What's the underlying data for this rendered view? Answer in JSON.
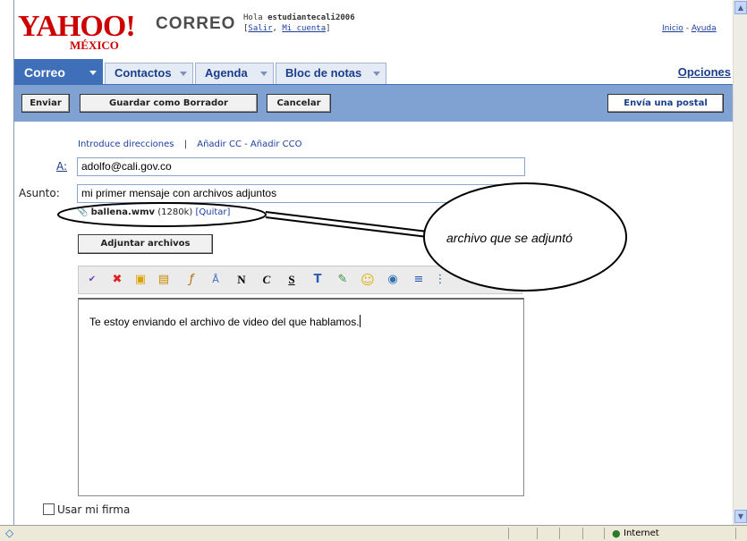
{
  "header": {
    "logo_text": "YAHOO!",
    "logo_region": "MÉXICO",
    "product": "CORREO",
    "greeting": "Hola",
    "username": "estudiantecali2006",
    "exit_link": "Salir",
    "account_link": "Mi cuenta",
    "home_link": "Inicio",
    "help_link": "Ayuda",
    "link_sep": "-"
  },
  "nav": {
    "tabs": [
      {
        "label": "Correo"
      },
      {
        "label": "Contactos"
      },
      {
        "label": "Agenda"
      },
      {
        "label": "Bloc de notas"
      }
    ],
    "options_label": "Opciones"
  },
  "actions": {
    "send": "Enviar",
    "save_draft": "Guardar como Borrador",
    "cancel": "Cancelar",
    "postcard": "Envía una postal"
  },
  "compose": {
    "insert_addresses": "Introduce direcciones",
    "add_cc": "Añadir CC",
    "add_bcc": "Añadir CCO",
    "cc_sep": "-",
    "pipe": "|",
    "to_label": "A:",
    "to_value": "adolfo@cali.gov.co",
    "subject_label": "Asunto:",
    "subject_value": "mi primer mensaje con archivos adjuntos",
    "attachment_name": "ballena.wmv",
    "attachment_size": "(1280k)",
    "attachment_remove": "[Quitar]",
    "attach_button": "Adjuntar archivos",
    "body_text": "Te estoy enviando el archivo de video del que hablamos.",
    "signature_label": "Usar mi firma"
  },
  "toolbar_icons": [
    "spellcheck-icon",
    "cut-icon",
    "copy-icon",
    "paste-icon",
    "font-icon",
    "font-size-icon",
    "bold-icon",
    "italic-icon",
    "underline-icon",
    "text-color-icon",
    "highlight-icon",
    "emoticon-icon",
    "insert-image-icon",
    "align-icon",
    "list-icon"
  ],
  "toolbar_labels": {
    "bold": "N",
    "italic": "C",
    "underline": "S"
  },
  "annotation": {
    "text": "archivo que se adjuntó"
  },
  "statusbar": {
    "zone": "Internet"
  },
  "colors": {
    "yahoo_red": "#cc0000",
    "nav_active": "#3e6fb8",
    "action_bar": "#7fa2d2",
    "link_blue": "#1b3d8c"
  }
}
